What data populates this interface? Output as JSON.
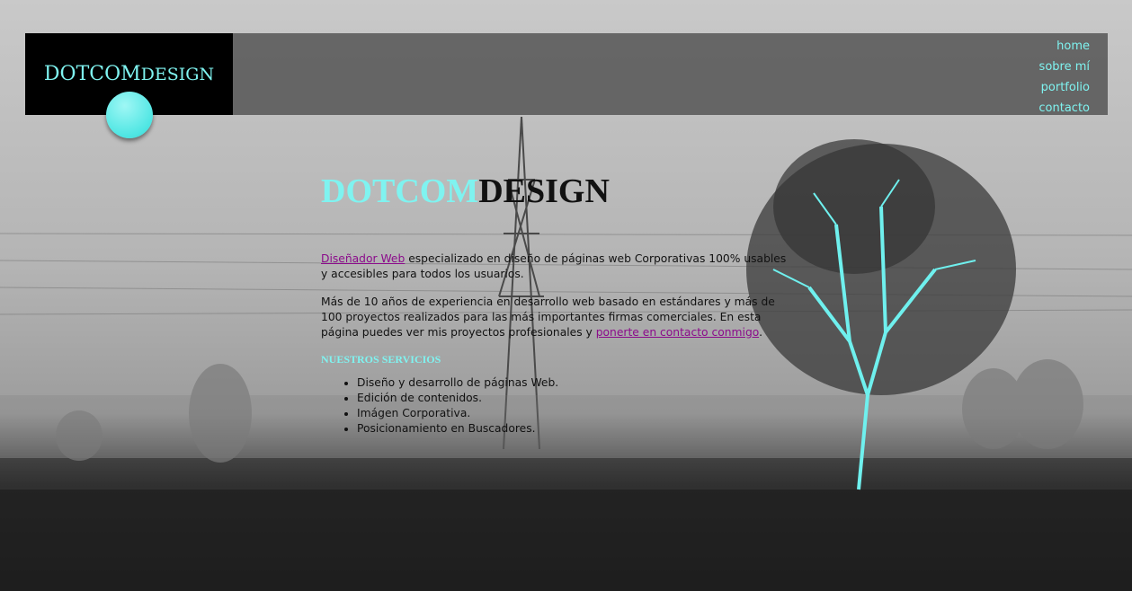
{
  "header": {
    "logo_part1": "DOTCOM",
    "logo_part2": "DESIGN"
  },
  "nav": [
    "home",
    "sobre mí",
    "portfolio",
    "contacto"
  ],
  "main": {
    "title_part1": "DOTCOM",
    "title_part2": "DESIGN",
    "p1_link": "Diseñador Web",
    "p1_text": " especializado en diseño de páginas web Corporativas 100% usables y accesibles para todos los usuarios.",
    "p2_text": "Más de 10 años de experiencia en desarrollo web basado en estándares y más de 100 proyectos realizados para las más importantes firmas comerciales. En esta página puedes ver mis proyectos profesionales y ",
    "p2_link": "ponerte en contacto conmigo",
    "p2_end": ".",
    "services_heading": "NUESTROS SERVICIOS",
    "services": [
      "Diseño y desarrollo de páginas Web.",
      "Edición de contenidos.",
      "Imágen Corporativa.",
      "Posicionamiento en Buscadores."
    ]
  },
  "colors": {
    "accent": "#7ff3f0",
    "link": "#8b0b8b",
    "header_bg": "#555555",
    "logo_bg": "#000000"
  }
}
